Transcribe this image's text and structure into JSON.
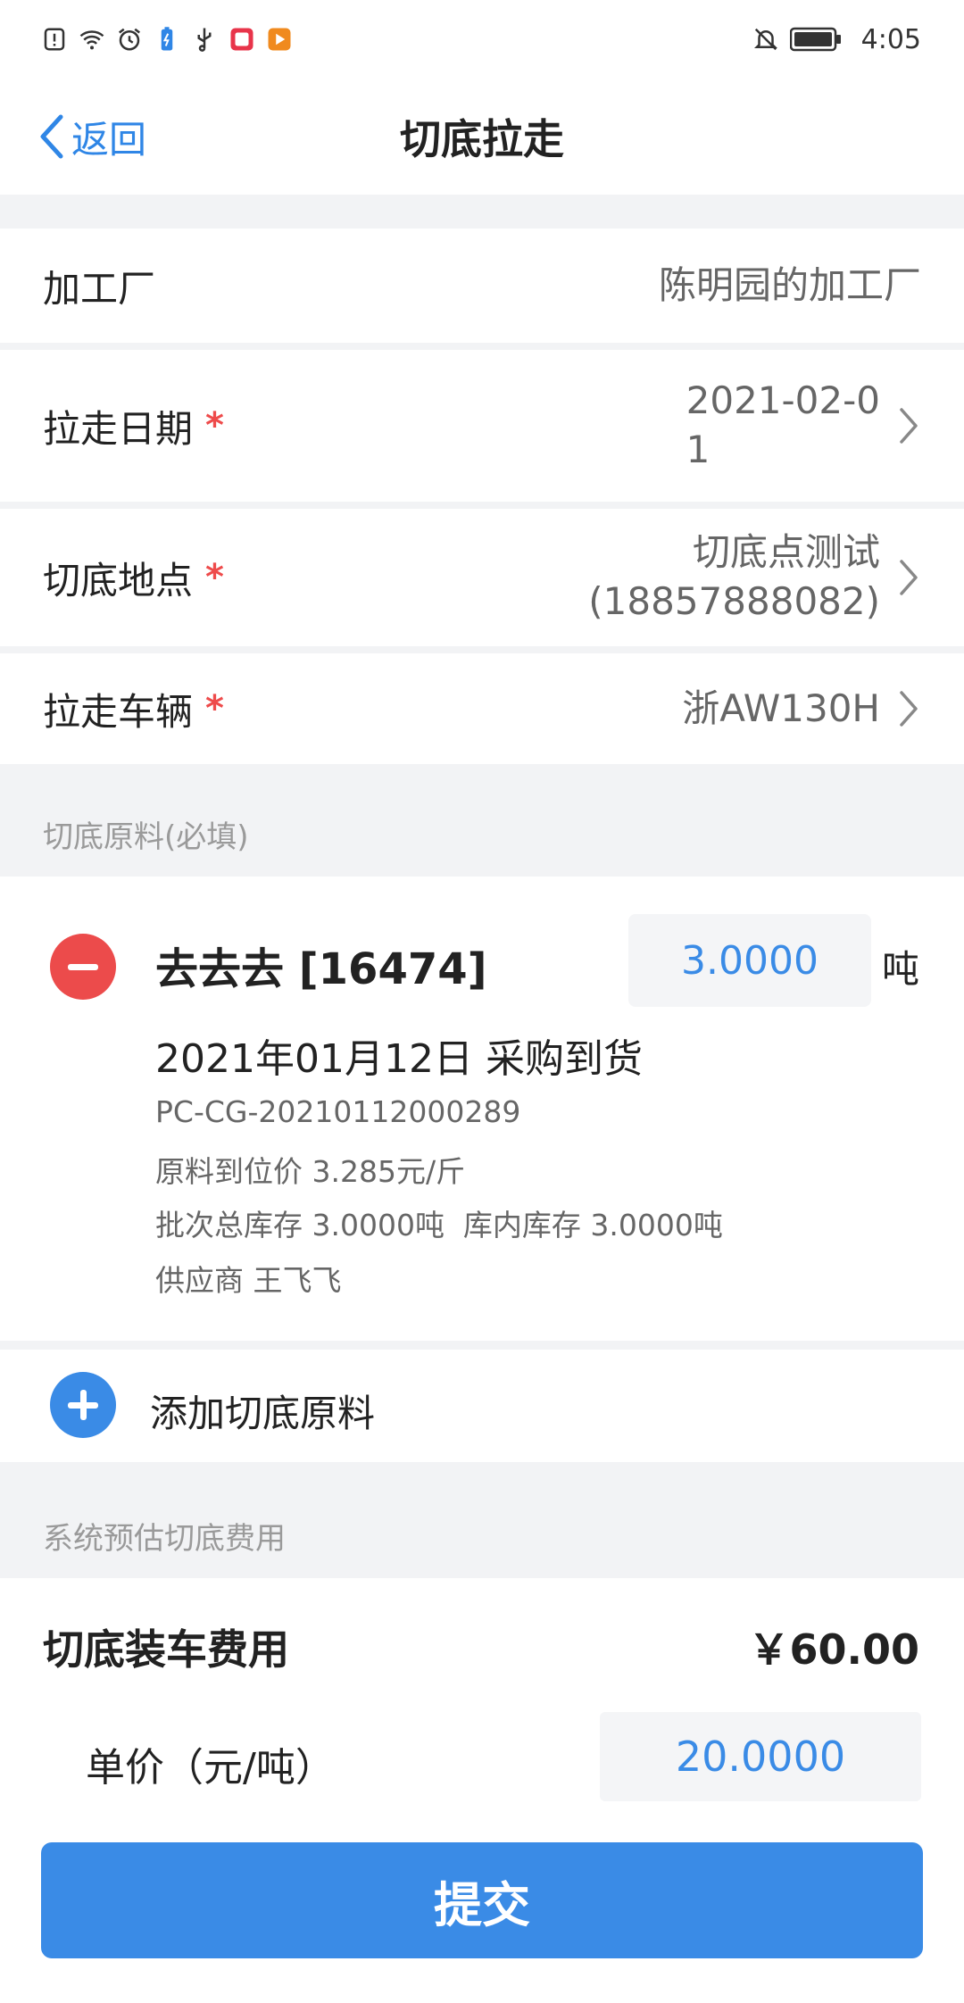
{
  "status_bar": {
    "time": "4:05",
    "left_icons": [
      "alert-icon",
      "wifi-icon",
      "alarm-icon",
      "battery-saver-icon",
      "usb-icon",
      "app-notification-icon",
      "video-app-icon"
    ],
    "right_icons": [
      "mute-bell-icon",
      "battery-icon"
    ]
  },
  "nav": {
    "back_label": "返回",
    "title": "切底拉走"
  },
  "form": {
    "factory": {
      "label": "加工厂",
      "value": "陈明园的加工厂"
    },
    "date": {
      "label": "拉走日期",
      "value_line1": "2021-02-0",
      "value_line2": "1"
    },
    "location": {
      "label": "切底地点",
      "value_line1": "切底点测试",
      "value_line2": "(18857888082)"
    },
    "vehicle": {
      "label": "拉走车辆",
      "value": "浙AW130H"
    },
    "required_mark": "*"
  },
  "materials_section": {
    "label": "切底原料(必填)",
    "items": [
      {
        "name": "去去去 [16474]",
        "quantity": "3.0000",
        "unit": "吨",
        "date_line": "2021年01月12日 采购到货",
        "code": "PC-CG-20210112000289",
        "price_line": "原料到位价 3.285元/斤",
        "stock_line": "批次总库存 3.0000吨  库内库存 3.0000吨",
        "supplier_line": "供应商 王飞飞"
      }
    ],
    "add_label": "添加切底原料"
  },
  "fee_section": {
    "label": "系统预估切底费用",
    "fee_title": "切底装车费用",
    "fee_amount": "￥60.00",
    "unit_price_label": "单价（元/吨）",
    "unit_price_value": "20.0000"
  },
  "submit_label": "提交",
  "colors": {
    "accent": "#3a8be6",
    "danger": "#ec4b4b",
    "required": "#ee4b4b"
  }
}
